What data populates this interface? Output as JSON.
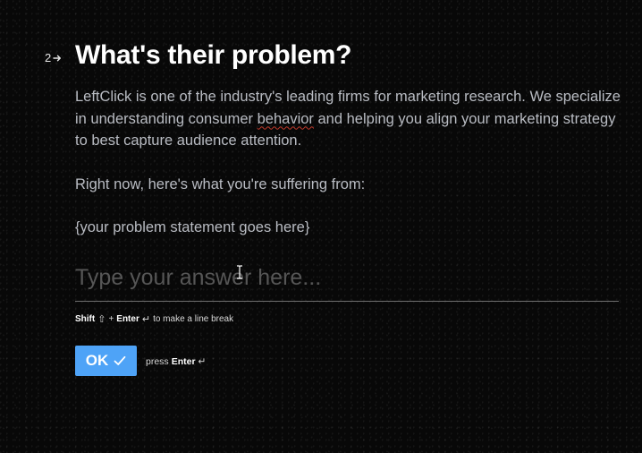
{
  "question": {
    "number": "2",
    "number_icon": "arrow-right-icon",
    "title": "What's their problem?",
    "desc_part1": "LeftClick is one of the industry's leading firms for marketing research. We specialize in understanding consumer ",
    "desc_misspelled": "behavior",
    "desc_part2": " and helping you align your marketing strategy to best capture audience attention.",
    "desc_line2": "Right now, here's what you're suffering from:",
    "desc_line3": "{your problem statement goes here}"
  },
  "answer": {
    "placeholder": "Type your answer here...",
    "value": ""
  },
  "hint": {
    "shift": "Shift",
    "shift_symbol": "⇧",
    "plus": "+",
    "enter": "Enter",
    "enter_symbol": "↵",
    "text": "to make a line break"
  },
  "ok": {
    "label": "OK",
    "check_icon": "check-icon",
    "press": "press",
    "enter": "Enter",
    "enter_symbol": "↵"
  },
  "colors": {
    "background": "#080808",
    "accent": "#4ea3f7",
    "text_secondary": "#b9bcc3",
    "placeholder": "#565656"
  }
}
